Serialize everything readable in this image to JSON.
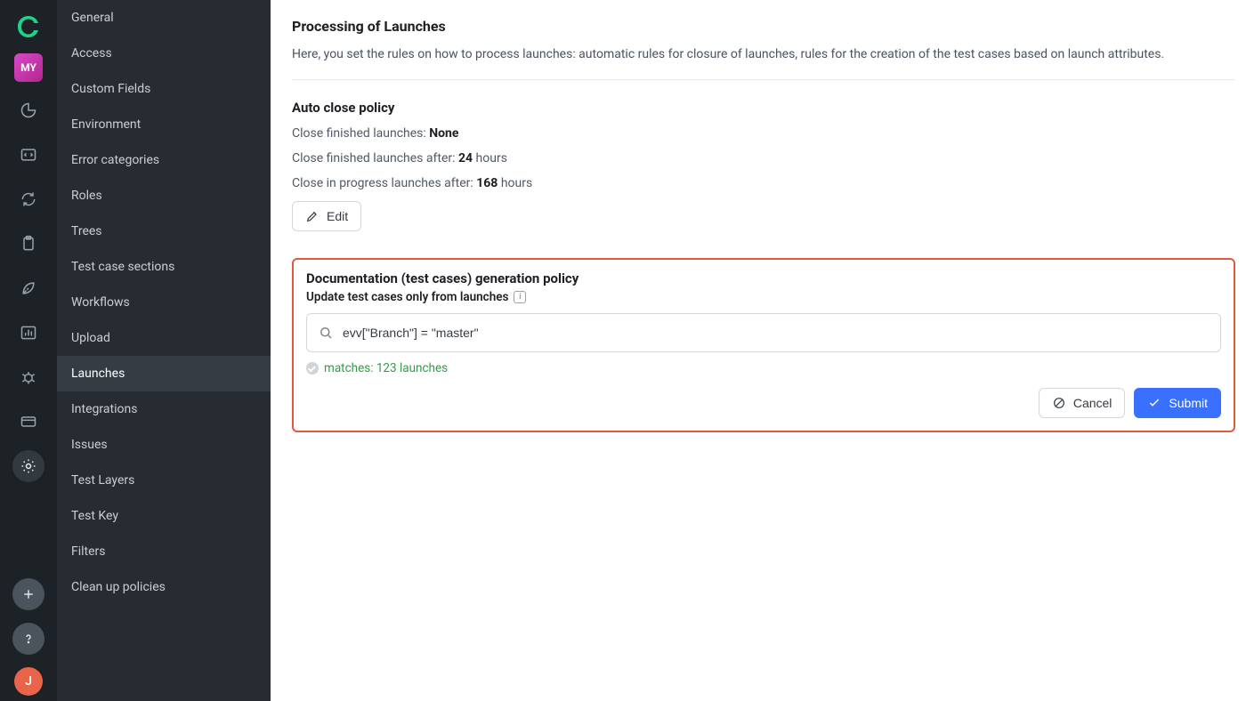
{
  "project_badge": "MY",
  "user_initial": "J",
  "sidebar": {
    "items": [
      {
        "label": "General"
      },
      {
        "label": "Access"
      },
      {
        "label": "Custom Fields"
      },
      {
        "label": "Environment"
      },
      {
        "label": "Error categories"
      },
      {
        "label": "Roles"
      },
      {
        "label": "Trees"
      },
      {
        "label": "Test case sections"
      },
      {
        "label": "Workflows"
      },
      {
        "label": "Upload"
      },
      {
        "label": "Launches"
      },
      {
        "label": "Integrations"
      },
      {
        "label": "Issues"
      },
      {
        "label": "Test Layers"
      },
      {
        "label": "Test Key"
      },
      {
        "label": "Filters"
      },
      {
        "label": "Clean up policies"
      }
    ]
  },
  "page": {
    "title": "Processing of Launches",
    "description": "Here, you set the rules on how to process launches: automatic rules for closure of launches, rules for the creation of the test cases based on launch attributes."
  },
  "auto_close": {
    "heading": "Auto close policy",
    "line1_label": "Close finished launches: ",
    "line1_value": "None",
    "line2_label": "Close finished launches after: ",
    "line2_value": "24",
    "line2_suffix": " hours",
    "line3_label": "Close in progress launches after: ",
    "line3_value": "168",
    "line3_suffix": " hours",
    "edit_label": "Edit"
  },
  "doc_policy": {
    "heading": "Documentation (test cases) generation policy",
    "sub_label": "Update test cases only from launches",
    "info_char": "i",
    "query_value": "evv[\"Branch\"] = \"master\"",
    "matches_text": "matches: 123 launches",
    "cancel_label": "Cancel",
    "submit_label": "Submit"
  }
}
